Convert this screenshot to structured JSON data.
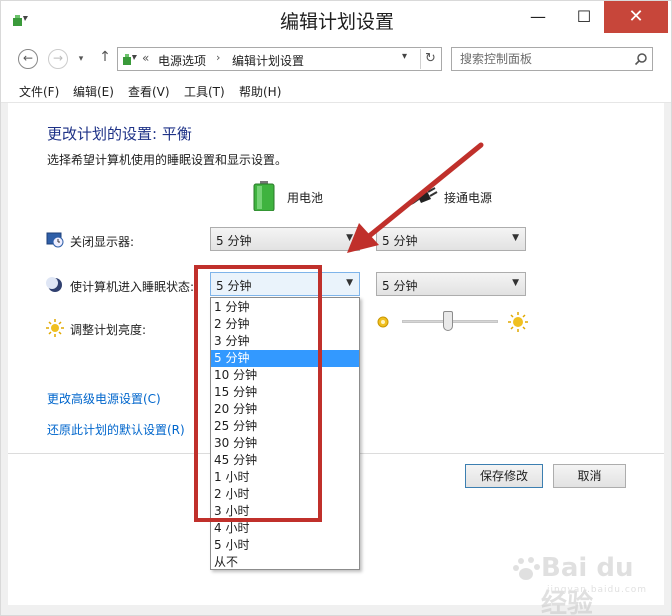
{
  "window": {
    "title": "编辑计划设置"
  },
  "colors": {
    "accent": "#1e3287",
    "link": "#0066cc",
    "selection": "#3399ff",
    "close": "#c7463a",
    "annotation": "#c0302b"
  },
  "nav": {
    "breadcrumb_sep": "«",
    "crumbs": [
      "电源选项",
      "编辑计划设置"
    ],
    "search_placeholder": "搜索控制面板"
  },
  "menu": [
    "文件(F)",
    "编辑(E)",
    "查看(V)",
    "工具(T)",
    "帮助(H)"
  ],
  "page": {
    "heading": "更改计划的设置: 平衡",
    "subheading": "选择希望计算机使用的睡眠设置和显示设置。",
    "col_battery": "用电池",
    "col_plugged": "接通电源"
  },
  "rows": {
    "display": {
      "label": "关闭显示器:",
      "battery": "5 分钟",
      "plugged": "5 分钟"
    },
    "sleep": {
      "label": "使计算机进入睡眠状态:",
      "battery": "5 分钟",
      "plugged": "5 分钟"
    },
    "brightness": {
      "label": "调整计划亮度:",
      "plugged_level": 0.4
    }
  },
  "links": {
    "advanced": "更改高级电源设置(C)",
    "restore": "还原此计划的默认设置(R)"
  },
  "buttons": {
    "save": "保存修改",
    "cancel": "取消"
  },
  "dropdown": {
    "selected_index": 3,
    "options": [
      "1 分钟",
      "2 分钟",
      "3 分钟",
      "5 分钟",
      "10 分钟",
      "15 分钟",
      "20 分钟",
      "25 分钟",
      "30 分钟",
      "45 分钟",
      "1 小时",
      "2 小时",
      "3 小时",
      "4 小时",
      "5 小时",
      "从不"
    ]
  },
  "watermark": {
    "text": "Bai du 经验",
    "sub": "jingyan.baidu.com"
  }
}
